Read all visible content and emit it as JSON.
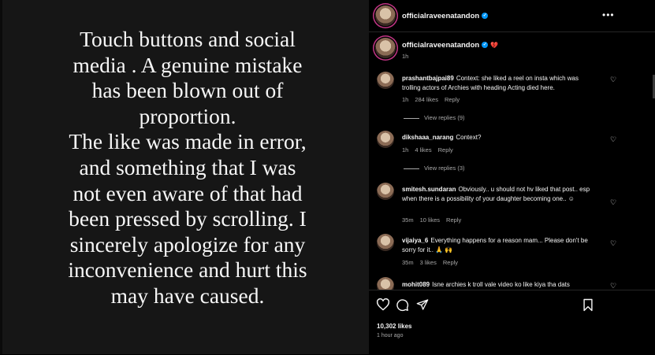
{
  "story": {
    "text": "Touch buttons and social\nmedia . A genuine mistake\nhas been blown out of\nproportion.\nThe like was made in error,\nand  something that I was\nnot even aware of that had\nbeen pressed by scrolling. I\nsincerely apologize for any\ninconvenience and hurt this\nmay have caused."
  },
  "header": {
    "username": "officialraveenatandon",
    "more": "•••"
  },
  "caption": {
    "username": "officialraveenatandon",
    "heart": "💔",
    "time": "1h"
  },
  "comments": [
    {
      "username": "prashantbajpai89",
      "text": "Context: she liked a reel on insta which was trolling actors of Archies with heading Acting died here.",
      "time": "1h",
      "likes": "284 likes",
      "reply": "Reply",
      "view_replies": "View replies (9)"
    },
    {
      "username": "dikshaaa_narang",
      "text": "Context?",
      "time": "1h",
      "likes": "4 likes",
      "reply": "Reply",
      "view_replies": "View replies (3)"
    },
    {
      "username": "smitesh.sundaran",
      "text": "Obviously.. u should not hv liked that post.. esp when there is a possibility of your daughter becoming one.. ☺",
      "time": "35m",
      "likes": "10 likes",
      "reply": "Reply"
    },
    {
      "username": "vijaiya_6",
      "text": "Everything happens for a reason mam... Please don't be sorry for it.. 🙏 🙌",
      "time": "35m",
      "likes": "3 likes",
      "reply": "Reply"
    },
    {
      "username": "mohit089",
      "text": "Isne archies k troll vale video ko like kiya tha dats"
    }
  ],
  "post": {
    "likes": "10,302 likes",
    "time_ago": "1 hour ago"
  },
  "icons": [
    "heart-icon",
    "comment-icon",
    "share-icon",
    "bookmark-icon",
    "more-icon",
    "verified-icon"
  ],
  "colors": {
    "verified": "#0095f6",
    "muted": "#a8a8a8",
    "story_bg": "#161616"
  }
}
